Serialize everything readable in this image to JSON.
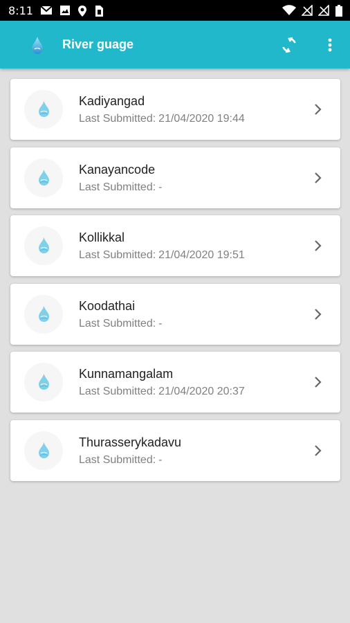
{
  "status_bar": {
    "time": "8:11",
    "left_icons": [
      "gmail-icon",
      "image-icon",
      "location-icon",
      "sim-icon"
    ],
    "right_icons": [
      "wifi-icon",
      "no-signal-icon",
      "no-signal-icon",
      "battery-icon"
    ]
  },
  "app_bar": {
    "title": "River guage",
    "accent_color": "#22b8cc",
    "logo_icon": "water-drop-icon",
    "actions": [
      "refresh-icon",
      "more-vert-icon"
    ]
  },
  "stations": {
    "submitted_label": "Last Submitted:",
    "items": [
      {
        "name": "Kadiyangad",
        "last_submitted": "21/04/2020 19:44"
      },
      {
        "name": "Kanayancode",
        "last_submitted": "-"
      },
      {
        "name": "Kollikkal",
        "last_submitted": "21/04/2020 19:51"
      },
      {
        "name": "Koodathai",
        "last_submitted": "-"
      },
      {
        "name": "Kunnamangalam",
        "last_submitted": "21/04/2020 20:37"
      },
      {
        "name": "Thurasserykadavu",
        "last_submitted": "-"
      }
    ]
  }
}
